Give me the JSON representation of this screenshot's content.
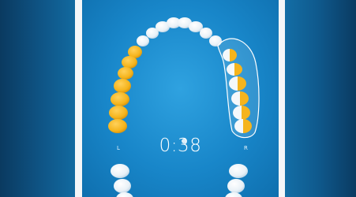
{
  "timer": {
    "value": "0:38"
  },
  "labels": {
    "left": "L",
    "right": "R"
  },
  "progress": {
    "upper_left_teeth_brushed": 7,
    "upper_right_quadrant_brushed": "partial"
  },
  "colors": {
    "brushed_tooth": "#f5b41c",
    "unbrushed_tooth": "#f2f7fb",
    "screen_background": "#1886c9",
    "backdrop": "#0f5789",
    "active_zone_outline": "#ffffff"
  },
  "icons": [
    "tooth-icon",
    "active-zone-outline"
  ]
}
